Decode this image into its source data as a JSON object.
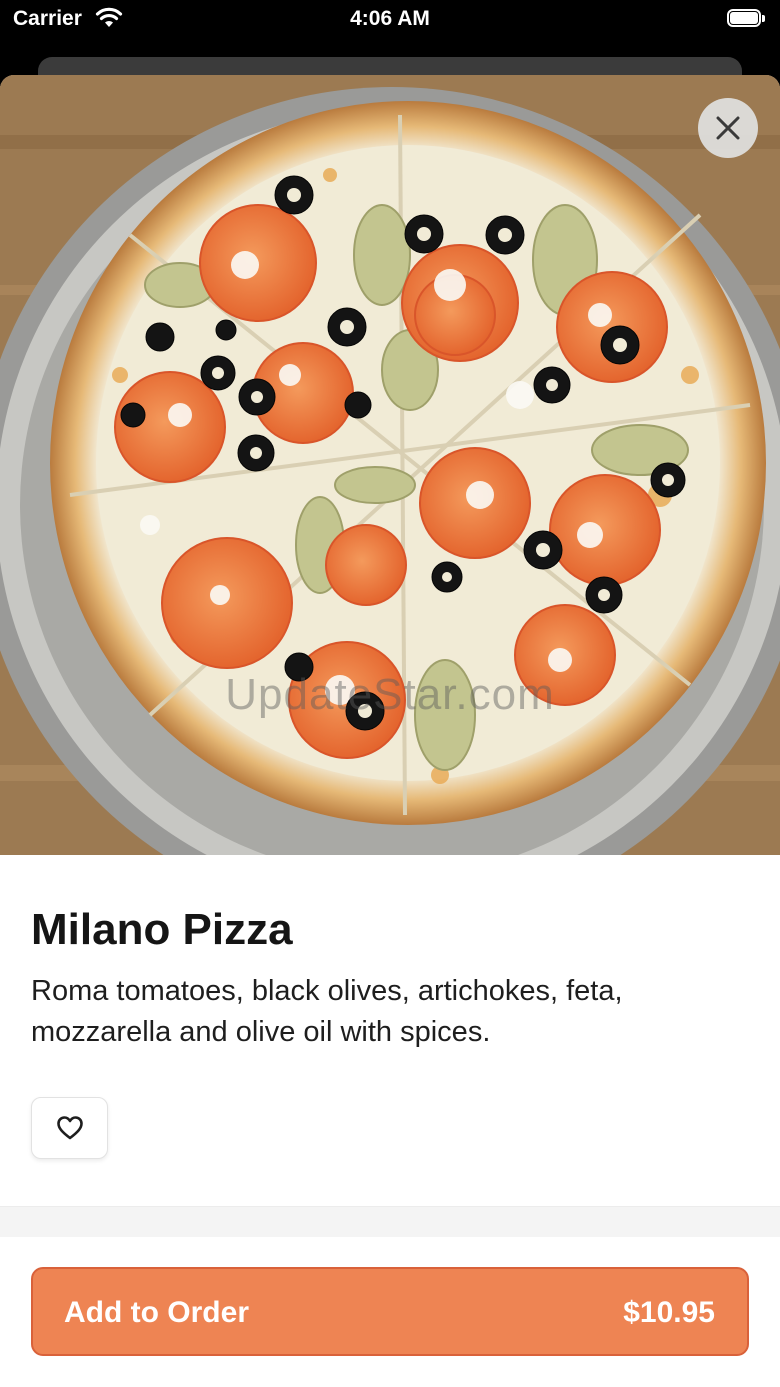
{
  "status_bar": {
    "carrier": "Carrier",
    "time": "4:06 AM"
  },
  "item": {
    "name": "Milano Pizza",
    "description": "Roma tomatoes, black olives, artichokes, feta, mozzarella and olive oil with spices.",
    "image_alt": "Milano Pizza photo"
  },
  "watermark": "UpdateStar.com",
  "actions": {
    "add_to_order_label": "Add to Order",
    "price": "$10.95"
  },
  "icons": {
    "close": "close-icon",
    "favorite": "heart-icon",
    "wifi": "wifi-icon",
    "battery": "battery-icon"
  },
  "colors": {
    "accent": "#ee8453",
    "accent_border": "#d9613a",
    "text": "#151515"
  }
}
